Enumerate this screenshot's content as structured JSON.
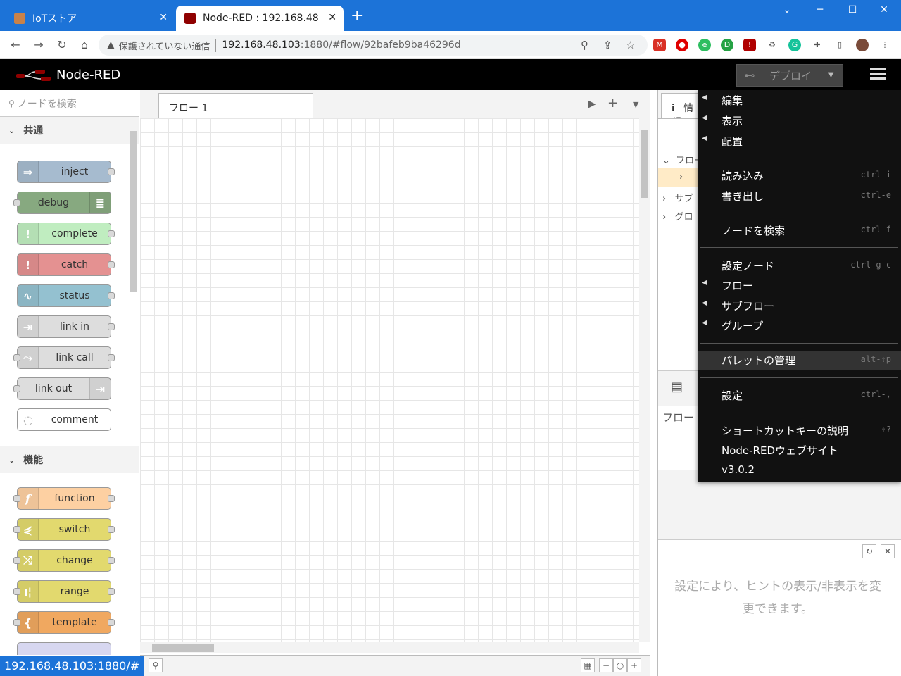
{
  "browser": {
    "tabs": [
      {
        "title": "IoTストア",
        "close": "✕"
      },
      {
        "title": "Node-RED : 192.168.48",
        "close": "✕"
      }
    ],
    "new_tab": "+",
    "address": {
      "security": "保護されていない通信",
      "host": "192.168.48.103",
      "path": ":1880/#flow/92bafeb9ba46296d"
    },
    "status_url": "192.168.48.103:1880/#"
  },
  "header": {
    "app_name": "Node-RED",
    "deploy_label": "デプロイ"
  },
  "palette": {
    "search_placeholder": "ノードを検索",
    "categories": [
      {
        "name": "共通",
        "nodes": [
          {
            "label": "inject",
            "color": "#a6bbcf"
          },
          {
            "label": "debug",
            "color": "#87a980"
          },
          {
            "label": "complete",
            "color": "#c0edc0"
          },
          {
            "label": "catch",
            "color": "#e49191"
          },
          {
            "label": "status",
            "color": "#94c1d0"
          },
          {
            "label": "link in",
            "color": "#dddddd"
          },
          {
            "label": "link call",
            "color": "#dddddd"
          },
          {
            "label": "link out",
            "color": "#dddddd"
          },
          {
            "label": "comment",
            "color": "#ffffff"
          }
        ]
      },
      {
        "name": "機能",
        "nodes": [
          {
            "label": "function",
            "color": "#fdd0a2"
          },
          {
            "label": "switch",
            "color": "#e2d96e"
          },
          {
            "label": "change",
            "color": "#e2d96e"
          },
          {
            "label": "range",
            "color": "#e2d96e"
          },
          {
            "label": "template",
            "color": "#f0a860"
          }
        ]
      }
    ]
  },
  "workspace": {
    "tab_label": "フロー 1"
  },
  "sidebar": {
    "tab_label": "情報",
    "tree": [
      "フロー",
      "サブ",
      "グロ"
    ],
    "flow_section_label": "フロー",
    "hint": "設定により、ヒントの表示/非表示を変更できます。"
  },
  "menu": {
    "items": [
      {
        "label": "編集",
        "submenu": true,
        "shortcut": ""
      },
      {
        "label": "表示",
        "submenu": true,
        "shortcut": ""
      },
      {
        "label": "配置",
        "submenu": true,
        "shortcut": ""
      },
      {
        "label": "読み込み",
        "submenu": false,
        "shortcut": "ctrl-i"
      },
      {
        "label": "書き出し",
        "submenu": false,
        "shortcut": "ctrl-e"
      },
      {
        "label": "ノードを検索",
        "submenu": false,
        "shortcut": "ctrl-f"
      },
      {
        "label": "設定ノード",
        "submenu": false,
        "shortcut": "ctrl-g c"
      },
      {
        "label": "フロー",
        "submenu": true,
        "shortcut": ""
      },
      {
        "label": "サブフロー",
        "submenu": true,
        "shortcut": ""
      },
      {
        "label": "グループ",
        "submenu": true,
        "shortcut": ""
      },
      {
        "label": "パレットの管理",
        "submenu": false,
        "shortcut": "alt-⇧p"
      },
      {
        "label": "設定",
        "submenu": false,
        "shortcut": "ctrl-,"
      },
      {
        "label": "ショートカットキーの説明",
        "submenu": false,
        "shortcut": "⇧?"
      },
      {
        "label": "Node-REDウェブサイト",
        "submenu": false,
        "shortcut": ""
      },
      {
        "label": "v3.0.2",
        "submenu": false,
        "shortcut": ""
      }
    ]
  }
}
